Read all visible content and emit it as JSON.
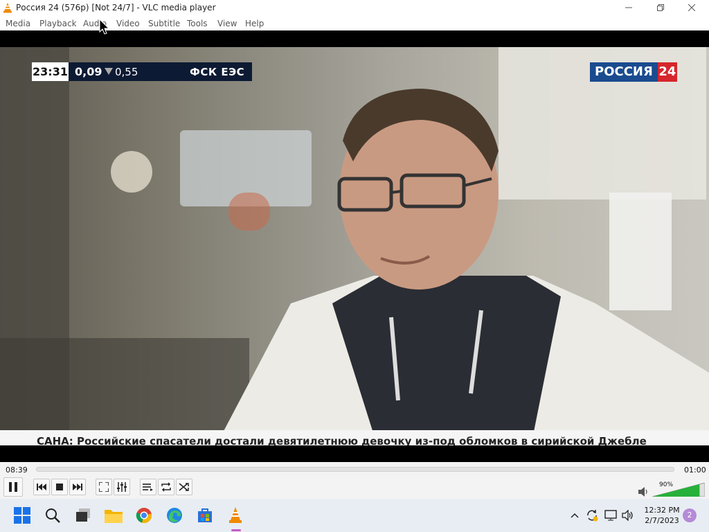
{
  "window": {
    "title": "Россия 24 (576p) [Not 24/7] - VLC media player",
    "icon": "vlc-cone-icon",
    "controls": [
      "minimize-icon",
      "maximize-icon",
      "close-icon"
    ]
  },
  "menubar": {
    "items": [
      "Media",
      "Playback",
      "Audio",
      "Video",
      "Subtitle",
      "Tools",
      "View",
      "Help"
    ]
  },
  "video": {
    "overlay_clock": "23:31",
    "overlay_value1": "0,09",
    "overlay_value2": "0,55",
    "overlay_ticker_name": "ФСК ЕЭС",
    "channel_logo_text": "РОССИЯ",
    "channel_logo_number": "24",
    "news_ticker": "САНА: Российские спасатели достали девятилетнюю девочку из-под обломков в сирийской Джебле",
    "colors": {
      "logo_blue": "#1a4b8f",
      "logo_red": "#d6252c",
      "overlay_bg": "#0d1a33"
    }
  },
  "player": {
    "elapsed": "08:39",
    "remaining": "01:00",
    "seek_fraction": 0.0,
    "volume_label": "90%",
    "volume_fraction": 0.9,
    "buttons": [
      {
        "name": "pause-button",
        "icon": "pause-icon"
      },
      {
        "name": "previous-button",
        "icon": "skip-back-icon"
      },
      {
        "name": "stop-button",
        "icon": "stop-icon"
      },
      {
        "name": "next-button",
        "icon": "skip-forward-icon"
      },
      {
        "name": "fullscreen-button",
        "icon": "fullscreen-icon"
      },
      {
        "name": "extended-settings-button",
        "icon": "equalizer-icon"
      },
      {
        "name": "playlist-button",
        "icon": "playlist-icon"
      },
      {
        "name": "loop-button",
        "icon": "loop-icon"
      },
      {
        "name": "shuffle-button",
        "icon": "shuffle-icon"
      }
    ]
  },
  "taskbar": {
    "apps": [
      "windows-start-icon",
      "search-icon",
      "task-view-icon",
      "file-explorer-icon",
      "chrome-icon",
      "edge-icon",
      "store-icon",
      "vlc-icon"
    ],
    "tray": [
      "chevron-up-icon",
      "sync-icon",
      "network-icon",
      "speaker-icon"
    ],
    "time": "12:32 PM",
    "date": "2/7/2023",
    "notifications": "2"
  }
}
